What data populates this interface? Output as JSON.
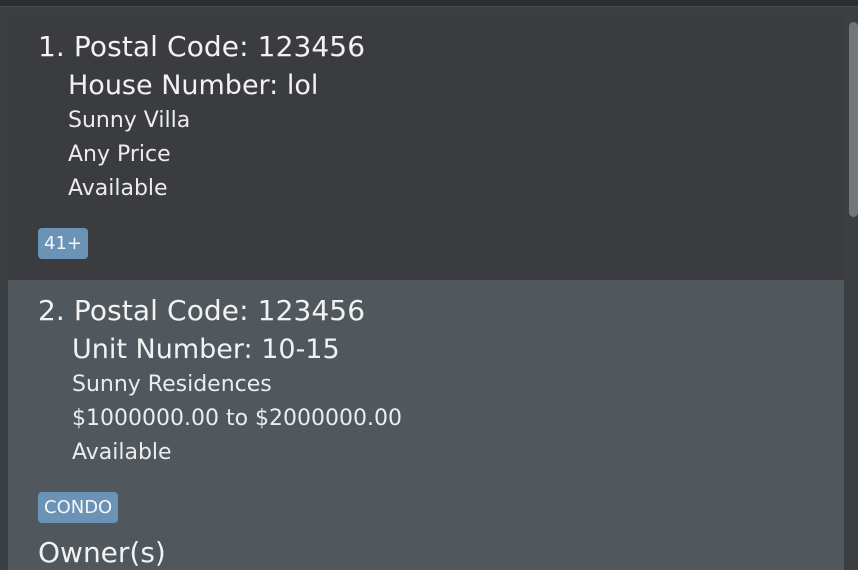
{
  "listings": [
    {
      "index_title": "1. Postal Code: 123456",
      "address_line": "House Number: lol",
      "property_name": "Sunny Villa",
      "price": "Any Price",
      "status": "Available",
      "tag": "41+"
    },
    {
      "index_title": "2. Postal Code: 123456",
      "address_line": "Unit Number: 10-15",
      "property_name": "Sunny Residences",
      "price": "$1000000.00 to $2000000.00",
      "status": "Available",
      "tag": "CONDO",
      "owners_heading": "Owner(s)"
    }
  ],
  "colors": {
    "tag_background": "#6b93b6",
    "card_selected_background": "#50585d",
    "card_background": "#3a3c40"
  }
}
